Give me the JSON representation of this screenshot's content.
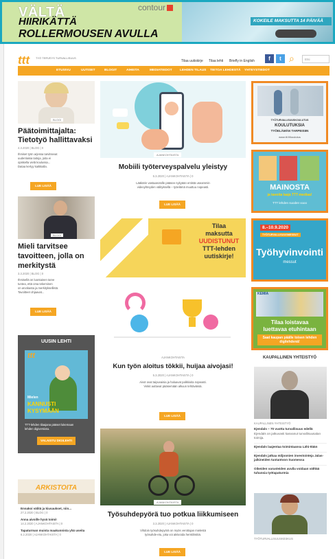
{
  "banner": {
    "line1": "VÄLTÄ",
    "line2": "HIIRIKÄTTÄ",
    "line3": "ROLLERMOUSEN AVULLA",
    "brand": "contour",
    "cta": "KOKEILE MAKSUTTA 14 PÄIVÄÄ"
  },
  "header": {
    "logo": "ttt",
    "logo_sub": "TYÖ TERVEYS TURVALLISUUS",
    "links": [
      "Tilaa uutiskirje",
      "Tilaa lehti",
      "Briefly in English"
    ],
    "search_placeholder": "Etsi"
  },
  "nav": [
    "ETUSIVU",
    "UUTISET",
    "BLOGIT",
    "AIHEITA",
    "MEDIATIEDOT",
    "LEHDEN TILAUS",
    "TIETOA LEHDESTÄ",
    "YHTEYSTIEDOT"
  ],
  "left": {
    "a1": {
      "badge": "BLOGI",
      "title1": "Päätoimittajalta:",
      "title2": "Tietotyö hallittavaksi",
      "meta": "4.3.2020 | BLOG | 0",
      "excerpt": [
        "Ihmiset työn arjessa tarvitsevat",
        "uudenlaisia taitoja, joita ei",
        "opiskella vielä koulussa...",
        "Dataa kertyy kaikkialla."
      ],
      "btn": "LUE LISÄÄ"
    },
    "a2": {
      "badge": "BLOGI",
      "title1": "Mieli tarvitsee",
      "title2": "tavoitteen, jolla on",
      "title3": "merkitystä",
      "meta": "3.3.2020 | BLOG | 0",
      "excerpt": [
        "Ihmisellä on luontainen tarve",
        "tuntea, että oma tekeminen",
        "on arvokasta ja merkityksellistä.",
        "Tavoitteet ohjaavat..."
      ],
      "btn": "LUE LISÄÄ"
    },
    "magazine": {
      "title": "UUSIN LEHTI",
      "cover_logo": "ttt",
      "cover_text1": "Mielen",
      "cover_text2": "KANNUSTI",
      "cover_text3": "KYSYMÄÄN",
      "caption": [
        "TTT-lehden tilaajana pääset lukemaan",
        "lehden digiversiota."
      ],
      "btn": "VALAISTU DIGILEHTI"
    },
    "archive": {
      "title": "ARKISTOITA",
      "items": [
        {
          "title": "Ennakoi välitä ja kiusaukset, niin...",
          "meta": "27.2.2020 | BLOG | 0"
        },
        {
          "title": "Anna aivoille hyvä toimi!",
          "meta": "14.2.2020 | AJANKOHTAISTA | 0"
        },
        {
          "title": "Tapaturman muista maakunnista yhä useita",
          "meta": "6.2.2020 | AJANKOHTAISTA | 0"
        }
      ]
    }
  },
  "center": {
    "a1": {
      "badge": "AJANKOHTAISTA",
      "title": "Mobiili työterveyspalvelu yleistyy",
      "meta": "5.3.2020 | AJANKOHTAISTA | 0",
      "excerpt": [
        "Lääkärin vastaanotolle pääsee nykyään entistä useammin",
        "videoyhteyden välityksellä – työelämä muuttuu nopeasti."
      ],
      "btn": "LUE LISÄÄ"
    },
    "promo": {
      "line1": "Tilaa",
      "line2": "maksutta",
      "line3": "UUDISTUNUT",
      "line4": "TTT-lehden",
      "line5": "uutiskirje!"
    },
    "a2": {
      "badge": "AJANKOHTAISTA",
      "title": "Kun työn aloitus tökkii, huijaa aivojasi!",
      "meta": "5.3.2020 | AJANKOHTAISTA | 0",
      "excerpt": [
        "Aivot ovat taipuvaisia ja haluavat palkkioita nopeasti.",
        "Vinkit auttavat pääsemään alkuun tehtävässä."
      ],
      "btn": "LUE LISÄÄ"
    },
    "a3": {
      "badge": "AJANKOHTAISTA",
      "title": "Työsuhdepyörä tuo potkua liikkumiseen",
      "meta": "3.3.2020 | AJANKOHTAISTA | 0",
      "excerpt": [
        "Vihdoin työsuhdepyörä on myös verottajan mielestä",
        "työsuhde-etu, joka voi aktivoida henkilöstöä."
      ],
      "btn": "LUE LISÄÄ"
    }
  },
  "right": {
    "ad1": {
      "line1": "TYÖTURVALLISUUSKOULUTUS",
      "line2": "KOULUTUKSIA",
      "line3": "TYÖELÄMÄN TARPEISIIN",
      "url": "www.ttl.fi/koulutus"
    },
    "ad2": {
      "line1": "MAINOSTA",
      "line2": "ja tavoita laaja TTT-mediaa!",
      "line3": "TTT lehden suoden vuoo"
    },
    "ad3": {
      "line1": "8.–10.9.2020",
      "line2": "TYÖTURVALLISUUSMESSUT",
      "line3": "Työhyvinvointi",
      "line4": "messut"
    },
    "ad4": {
      "line1": "KEMIA",
      "line2": "Tilaa loistavaa",
      "line3": "luettavaa etuhintaan",
      "line4": "Saat kaupan päälle toisen lehden digilehdenä!"
    },
    "commercial": {
      "title": "KAUPALLINEN YHTEISTYÖ",
      "meta": "KAUPALLINEN YHTEISTYÖ",
      "items": [
        "Ejendals – 70 vuotta turvallisuus edellä",
        "Ejendals on jatkuvasti kasvanut turvallisuusalan toimija.",
        "Ejendals laajentaa toimintaansa Lähi-Itään",
        "Ejendals jatkaa miljoonien investointeja Jalas-jalkineiden tuotantoon Suomessa",
        "Oikeiden varusteiden avulla voidaan välttää tuhansia työtapaturmia"
      ],
      "meta2": "TYÖTURVALLISUUSKESKUS"
    }
  }
}
